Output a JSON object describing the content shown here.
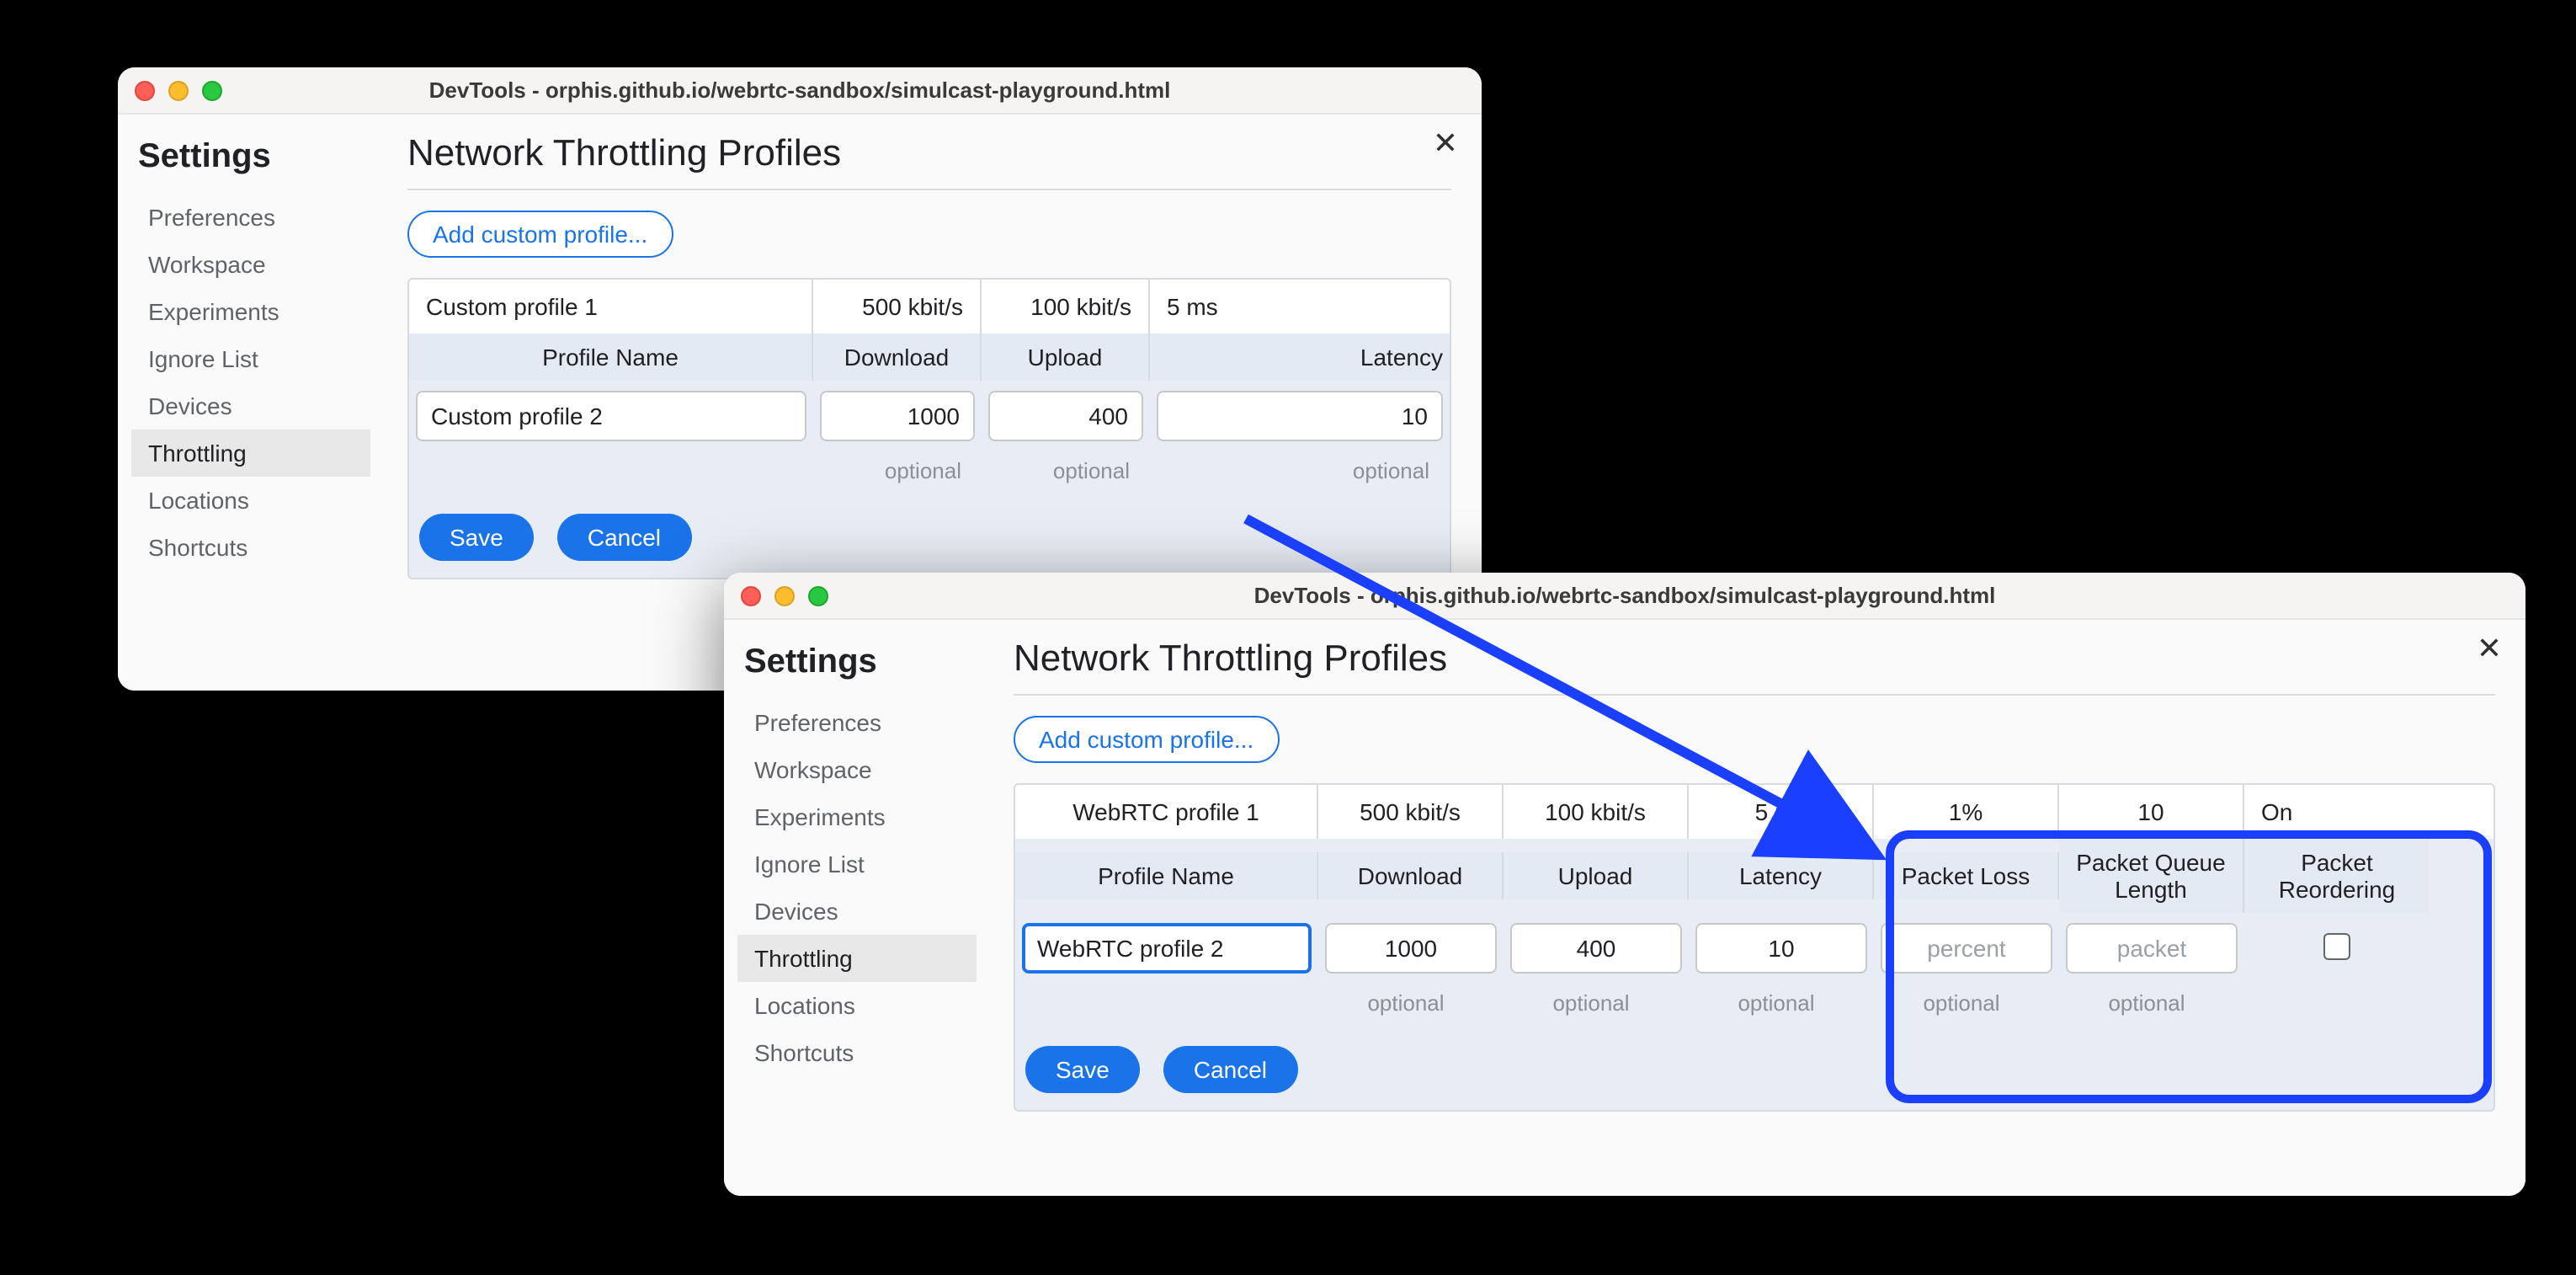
{
  "window_title": "DevTools - orphis.github.io/webrtc-sandbox/simulcast-playground.html",
  "settings_heading": "Settings",
  "sidebar": {
    "items": [
      {
        "label": "Preferences"
      },
      {
        "label": "Workspace"
      },
      {
        "label": "Experiments"
      },
      {
        "label": "Ignore List"
      },
      {
        "label": "Devices"
      },
      {
        "label": "Throttling"
      },
      {
        "label": "Locations"
      },
      {
        "label": "Shortcuts"
      }
    ],
    "active_index": 5
  },
  "page_title": "Network Throttling Profiles",
  "add_button": "Add custom profile...",
  "columns_basic": [
    "Profile Name",
    "Download",
    "Upload",
    "Latency"
  ],
  "columns_ext": [
    "Profile Name",
    "Download",
    "Upload",
    "Latency",
    "Packet Loss",
    "Packet Queue Length",
    "Packet Reordering"
  ],
  "win1": {
    "existing": {
      "name": "Custom profile 1",
      "download": "500 kbit/s",
      "upload": "100 kbit/s",
      "latency": "5 ms"
    },
    "edit": {
      "name": "Custom profile 2",
      "download": "1000",
      "upload": "400",
      "latency": "10"
    }
  },
  "win2": {
    "existing": {
      "name": "WebRTC profile 1",
      "download": "500 kbit/s",
      "upload": "100 kbit/s",
      "latency": "5 ms",
      "loss": "1%",
      "queue": "10",
      "reorder": "On"
    },
    "edit": {
      "name": "WebRTC profile 2",
      "download": "1000",
      "upload": "400",
      "latency": "10",
      "loss": "",
      "queue": ""
    },
    "placeholders": {
      "loss": "percent",
      "queue": "packet"
    }
  },
  "hint": "optional",
  "buttons": {
    "save": "Save",
    "cancel": "Cancel"
  }
}
